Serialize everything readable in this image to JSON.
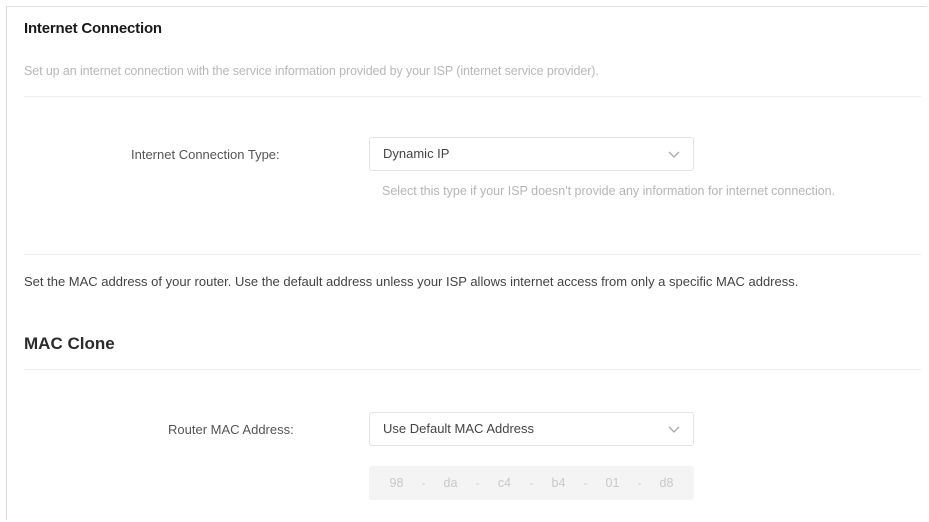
{
  "internet": {
    "title": "Internet Connection",
    "description": "Set up an internet connection with the service information provided by your ISP (internet service provider).",
    "connection_type_label": "Internet Connection Type:",
    "connection_type_value": "Dynamic IP",
    "connection_type_hint": "Select this type if your ISP doesn't provide any information for internet connection."
  },
  "mac": {
    "description": "Set the MAC address of your router. Use the default address unless your ISP allows internet access from only a specific MAC address.",
    "title": "MAC Clone",
    "router_mac_label": "Router MAC Address:",
    "router_mac_value": "Use Default MAC Address",
    "octets": [
      "98",
      "da",
      "c4",
      "b4",
      "01",
      "d8"
    ],
    "separator": "-"
  },
  "icons": {
    "dropdown": "chevron-down-icon"
  },
  "colors": {
    "title": "#1a1a1a",
    "muted_text": "#b8b8b8",
    "body_text": "#444444",
    "border": "#e3e3e3",
    "disabled_bg": "#f4f4f4"
  }
}
